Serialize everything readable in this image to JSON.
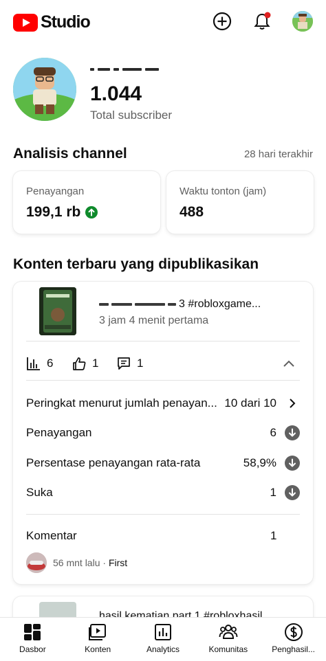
{
  "app": {
    "logo_text": "Studio",
    "brand_color": "#ff0000"
  },
  "header": {
    "icons": [
      "add-icon",
      "bell-icon",
      "account-avatar"
    ],
    "notification_dot_color": "#e02020"
  },
  "channel": {
    "subscriber_count": "1.044",
    "subscriber_label": "Total subscriber"
  },
  "analytics": {
    "title": "Analisis channel",
    "period": "28 hari terakhir",
    "cards": [
      {
        "label": "Penayangan",
        "value": "199,1 rb",
        "trend": "up",
        "trend_color": "#0f8a2c"
      },
      {
        "label": "Waktu tonton (jam)",
        "value": "488"
      }
    ]
  },
  "recent": {
    "title": "Konten terbaru yang dipublikasikan",
    "video": {
      "title_visible": "3 #robloxgame...",
      "time": "3 jam 4 menit pertama",
      "views": "6",
      "likes": "1",
      "comments": "1"
    },
    "rows": [
      {
        "label": "Peringkat menurut jumlah penayan...",
        "value": "10 dari 10",
        "icon": "chevron-right-icon"
      },
      {
        "label": "Penayangan",
        "value": "6",
        "icon": "down-circle-icon"
      },
      {
        "label": "Persentase penayangan rata-rata",
        "value": "58,9%",
        "icon": "down-circle-icon"
      },
      {
        "label": "Suka",
        "value": "1",
        "icon": "down-circle-icon"
      }
    ],
    "comments_section": {
      "label": "Komentar",
      "count": "1",
      "latest_time": "56 mnt lalu",
      "separator": "·",
      "latest_tag": "First"
    },
    "next_video": {
      "title_visible": "hasil kematian part 1 #robloxhasil"
    }
  },
  "bottom_nav": [
    {
      "label": "Dasbor",
      "icon": "dashboard-icon"
    },
    {
      "label": "Konten",
      "icon": "content-icon"
    },
    {
      "label": "Analytics",
      "icon": "analytics-icon"
    },
    {
      "label": "Komunitas",
      "icon": "community-icon"
    },
    {
      "label": "Penghasil...",
      "icon": "earn-icon"
    }
  ]
}
